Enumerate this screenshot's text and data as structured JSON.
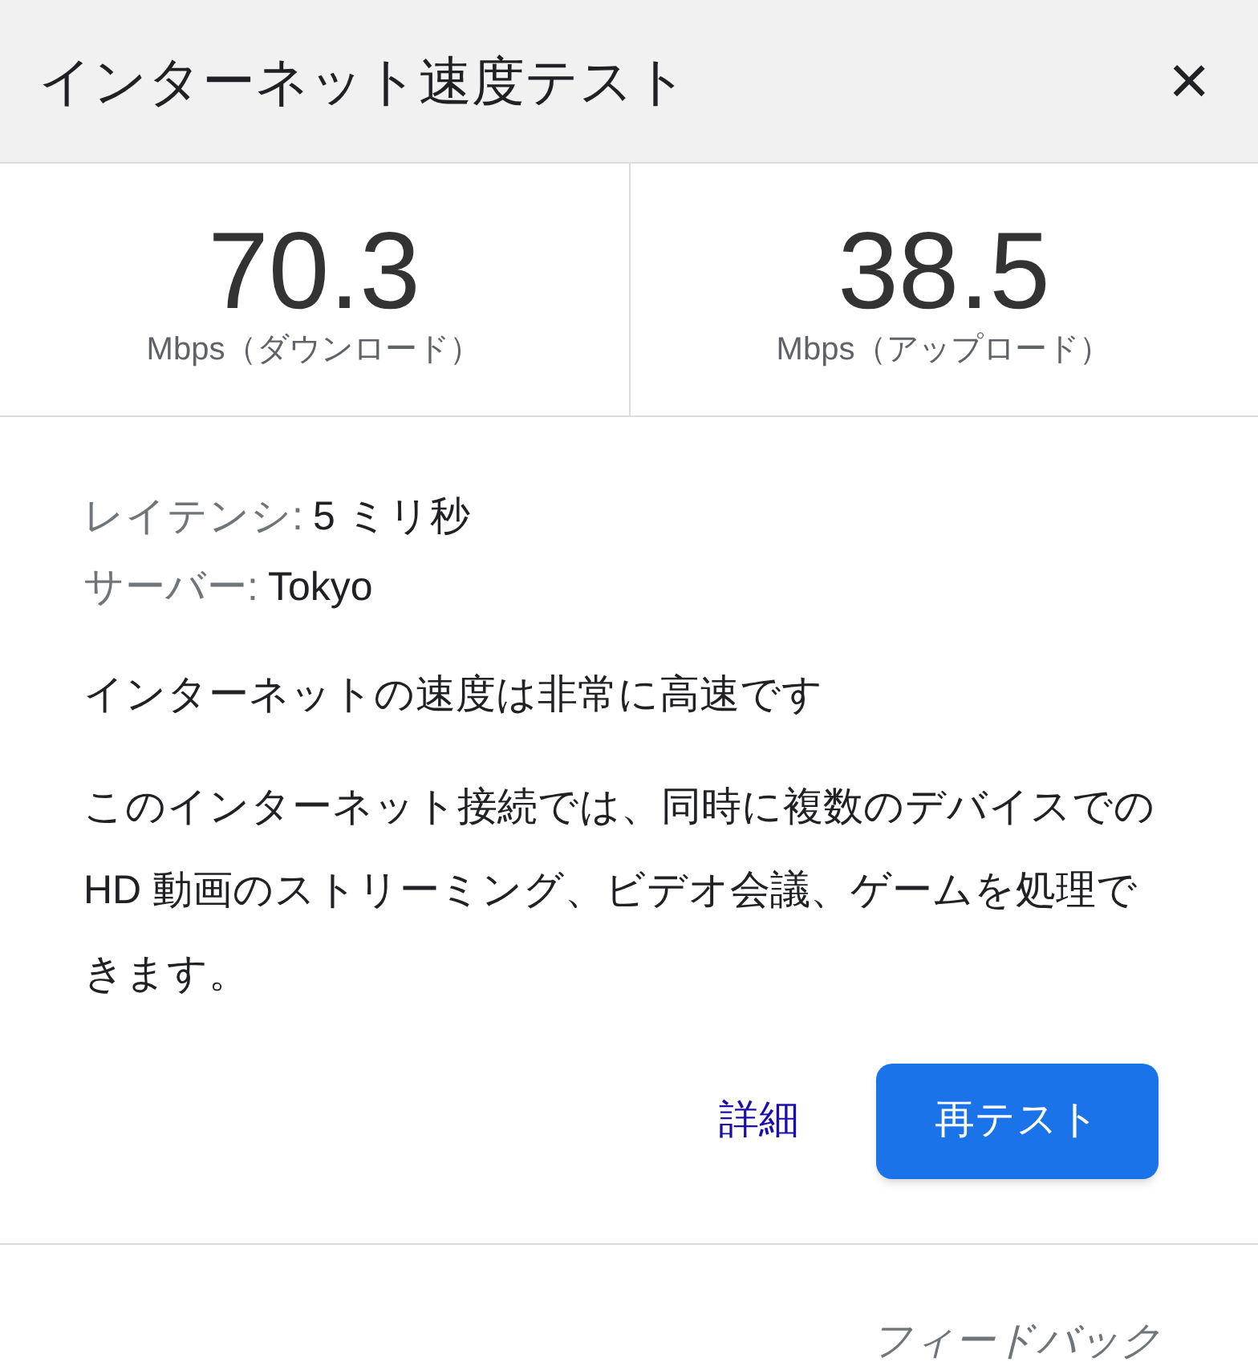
{
  "dialog": {
    "title": "インターネット速度テスト",
    "close": "×"
  },
  "results": [
    {
      "value": "70.3",
      "label": "Mbps（ダウンロード）"
    },
    {
      "value": "38.5",
      "label": "Mbps（アップロード）"
    }
  ],
  "details": [
    {
      "label": "レイテンシ:",
      "value": "5 ミリ秒"
    },
    {
      "label": "サーバー:",
      "value": "Tokyo"
    }
  ],
  "summary": "インターネットの速度は非常に高速です",
  "description": "このインターネット接続では、同時に複数のデバイスでの HD 動画のストリーミング、ビデオ会議、ゲームを処理できます。",
  "actions": {
    "link": "詳細",
    "button": "再テスト"
  },
  "feedback": "フィードバック"
}
